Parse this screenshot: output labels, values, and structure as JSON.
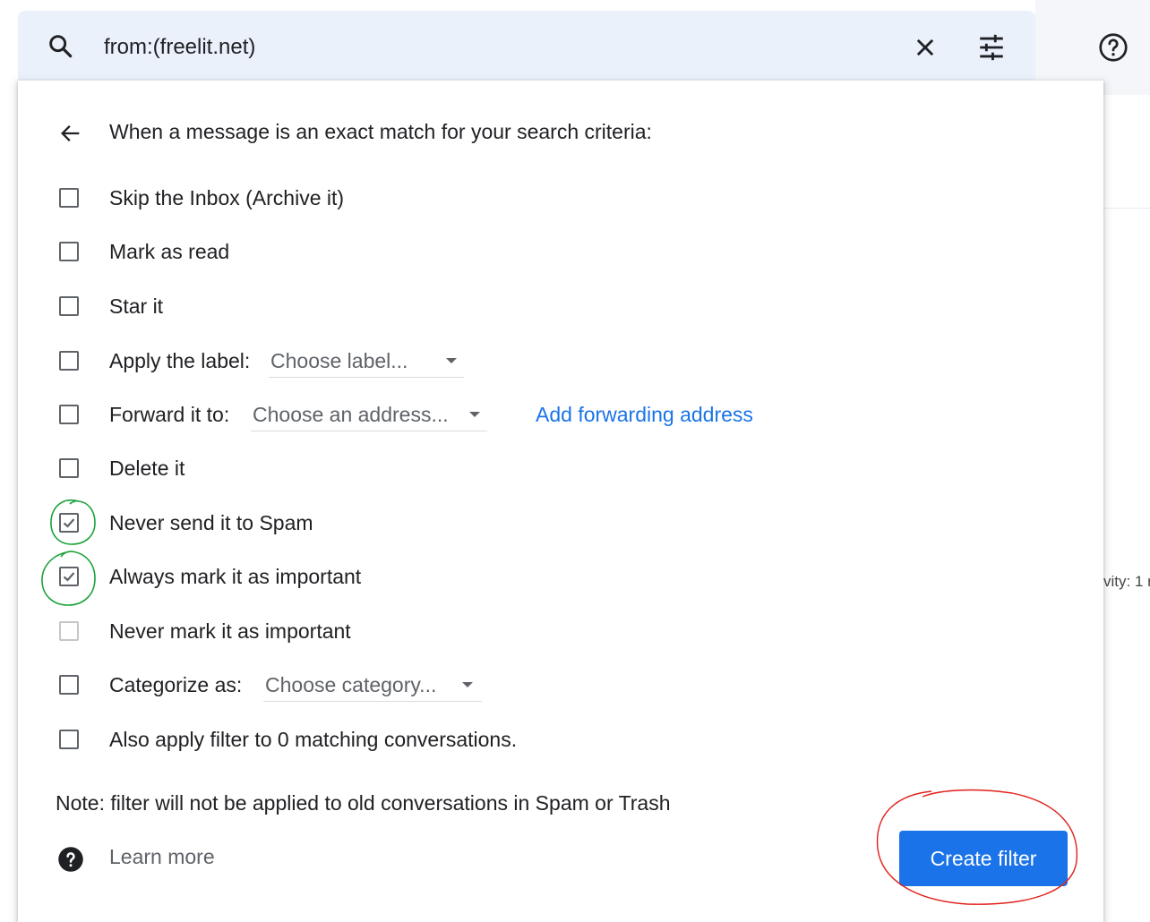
{
  "colors": {
    "accent": "#1a73e8",
    "search_bg": "#eaf1fb",
    "annotation_green": "#1aa33a",
    "annotation_red": "#e0201a"
  },
  "search": {
    "value": "from:(freelit.net)",
    "icons": [
      "search-icon",
      "close-icon",
      "tune-icon",
      "help-icon"
    ]
  },
  "background": {
    "partial_text": "vity: 1 r"
  },
  "filter": {
    "heading": "When a message is an exact match for your search criteria:",
    "options": [
      {
        "label": "Skip the Inbox (Archive it)",
        "checked": false
      },
      {
        "label": "Mark as read",
        "checked": false
      },
      {
        "label": "Star it",
        "checked": false
      },
      {
        "label": "Apply the label:",
        "checked": false,
        "select": "Choose label..."
      },
      {
        "label": "Forward it to:",
        "checked": false,
        "select": "Choose an address...",
        "link": "Add forwarding address"
      },
      {
        "label": "Delete it",
        "checked": false
      },
      {
        "label": "Never send it to Spam",
        "checked": true
      },
      {
        "label": "Always mark it as important",
        "checked": true
      },
      {
        "label": "Never mark it as important",
        "checked": false,
        "disabled": true
      },
      {
        "label": "Categorize as:",
        "checked": false,
        "select": "Choose category..."
      },
      {
        "label": "Also apply filter to 0 matching conversations.",
        "checked": false
      }
    ],
    "note": "Note: filter will not be applied to old conversations in Spam or Trash",
    "learn_more": "Learn more",
    "create_button": "Create filter"
  }
}
